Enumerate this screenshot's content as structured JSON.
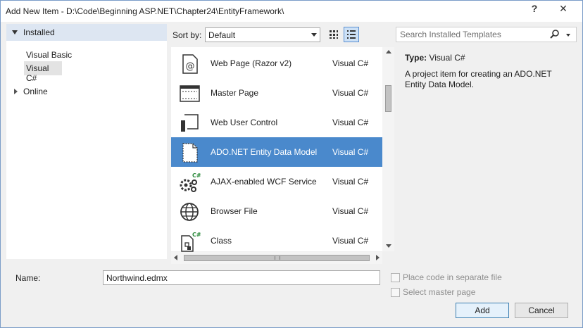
{
  "window": {
    "title": "Add New Item - D:\\Code\\Beginning ASP.NET\\Chapter24\\EntityFramework\\",
    "help_glyph": "?",
    "close_glyph": "✕"
  },
  "left_pane": {
    "installed_label": "Installed",
    "items": [
      "Visual Basic",
      "Visual C#"
    ],
    "online_label": "Online"
  },
  "toolbar": {
    "sort_label": "Sort by:",
    "sort_value": "Default",
    "search_placeholder": "Search Installed Templates"
  },
  "templates": [
    {
      "name": "Web Page (Razor v2)",
      "type": "Visual C#",
      "icon": "web-page-icon",
      "selected": false
    },
    {
      "name": "Master Page",
      "type": "Visual C#",
      "icon": "master-page-icon",
      "selected": false
    },
    {
      "name": "Web User Control",
      "type": "Visual C#",
      "icon": "user-control-icon",
      "selected": false
    },
    {
      "name": "ADO.NET Entity Data Model",
      "type": "Visual C#",
      "icon": "data-model-icon",
      "selected": true
    },
    {
      "name": "AJAX-enabled WCF Service",
      "type": "Visual C#",
      "icon": "wcf-service-icon",
      "selected": false
    },
    {
      "name": "Browser File",
      "type": "Visual C#",
      "icon": "browser-file-icon",
      "selected": false
    },
    {
      "name": "Class",
      "type": "Visual C#",
      "icon": "class-file-icon",
      "selected": false
    }
  ],
  "details": {
    "type_label": "Type:",
    "type_value": "Visual C#",
    "description": "A project item for creating an ADO.NET Entity Data Model."
  },
  "form": {
    "name_label": "Name:",
    "name_value": "Northwind.edmx",
    "place_code_label": "Place code in separate file",
    "select_master_label": "Select master page"
  },
  "buttons": {
    "add": "Add",
    "cancel": "Cancel"
  },
  "colors": {
    "selection": "#4a89cc",
    "tree_header": "#dde6f2"
  }
}
